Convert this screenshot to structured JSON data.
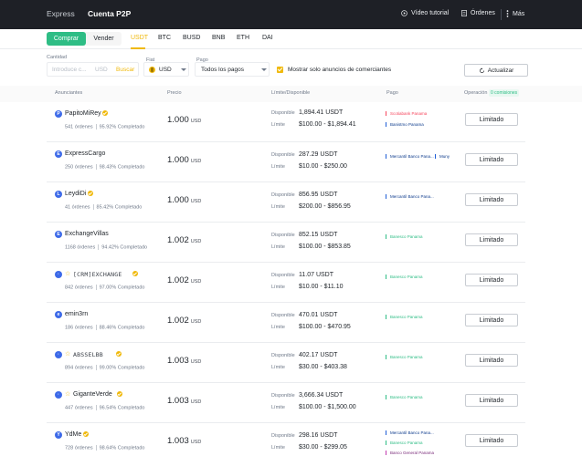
{
  "topbar": {
    "tabs": [
      "Express",
      "Cuenta P2P"
    ],
    "video": "Vídeo tutorial",
    "orders": "Órdenes",
    "more": "Más"
  },
  "nav": {
    "buy": "Comprar",
    "sell": "Vender",
    "assets": [
      "USDT",
      "BTC",
      "BUSD",
      "BNB",
      "ETH",
      "DAI"
    ]
  },
  "filters": {
    "amount_label": "Cantidad",
    "amount_placeholder": "Introduce c...",
    "amount_currency": "USD",
    "search": "Buscar",
    "fiat_label": "Fiat",
    "fiat_value": "USD",
    "payment_label": "Pago",
    "payment_value": "Todos los pagos",
    "merchant_only": "Mostrar solo anuncios de comerciantes",
    "refresh": "Actualizar"
  },
  "table": {
    "headers": [
      "Anunciantes",
      "Precio",
      "Límite/Disponible",
      "Pago",
      "Operación"
    ],
    "fee_badge": "0 comisiones",
    "available_label": "Disponible",
    "limit_label": "Límite",
    "price_unit": "USD",
    "action": "Limitado",
    "rows": [
      {
        "initial": "P",
        "name": "PapitoMiRey",
        "orders": "541 órdenes",
        "rate": "95.92% Completado",
        "price": "1.000",
        "available": "1,894.41 USDT",
        "limit": "$100.00 - $1,894.41",
        "payments": [
          {
            "name": "Scotiabank Panama",
            "color": "red"
          },
          {
            "name": "Banistmo Panama",
            "color": "blue"
          }
        ]
      },
      {
        "initial": "E",
        "name": "ExpressCargo",
        "orders": "250 órdenes",
        "rate": "98.43% Completado",
        "price": "1.000",
        "available": "287.29 USDT",
        "limit": "$10.00 - $250.00",
        "payments": [
          {
            "name": "Mercantil Banco Pana...",
            "color": "blue"
          },
          {
            "name": "Muny",
            "color": "blue"
          }
        ]
      },
      {
        "initial": "L",
        "name": "LeydiDi",
        "orders": "41 órdenes",
        "rate": "85.42% Completado",
        "price": "1.000",
        "available": "856.95 USDT",
        "limit": "$200.00 - $856.95",
        "payments": [
          {
            "name": "Mercantil Banco Pana...",
            "color": "blue"
          }
        ]
      },
      {
        "initial": "E",
        "name": "ExchangeVillas",
        "orders": "1168 órdenes",
        "rate": "94.42% Completado",
        "price": "1.002",
        "available": "852.15 USDT",
        "limit": "$100.00 - $853.85",
        "payments": [
          {
            "name": "Banesco Panama",
            "color": "green"
          }
        ]
      },
      {
        "initial": "·",
        "name": "[CRM]EXCHANGE",
        "orders": "842 órdenes",
        "rate": "97.00% Completado",
        "price": "1.002",
        "available": "11.07 USDT",
        "limit": "$10.00 - $11.10",
        "payments": [
          {
            "name": "Banesco Panama",
            "color": "green"
          }
        ]
      },
      {
        "initial": "e",
        "name": "emin3rn",
        "orders": "186 órdenes",
        "rate": "88.46% Completado",
        "price": "1.002",
        "available": "470.01 USDT",
        "limit": "$100.00 - $470.95",
        "payments": [
          {
            "name": "Banesco Panama",
            "color": "green"
          }
        ]
      },
      {
        "initial": "·",
        "name": "ABSSELBB",
        "orders": "894 órdenes",
        "rate": "99.00% Completado",
        "price": "1.003",
        "available": "402.17 USDT",
        "limit": "$30.00 - $403.38",
        "payments": [
          {
            "name": "Banesco Panama",
            "color": "green"
          }
        ]
      },
      {
        "initial": "·",
        "name": "GiganteVerde",
        "orders": "447 órdenes",
        "rate": "96.54% Completado",
        "price": "1.003",
        "available": "3,666.34 USDT",
        "limit": "$100.00 - $1,500.00",
        "payments": [
          {
            "name": "Banesco Panama",
            "color": "green"
          }
        ]
      },
      {
        "initial": "Y",
        "name": "YdMe",
        "orders": "728 órdenes",
        "rate": "98.64% Completado",
        "price": "1.003",
        "available": "298.16 USDT",
        "limit": "$30.00 - $299.05",
        "payments": [
          {
            "name": "Mercantil Banco Pana...",
            "color": "blue"
          },
          {
            "name": "Banesco Panama",
            "color": "green"
          },
          {
            "name": "Banco General Panama",
            "color": "pink"
          }
        ]
      }
    ]
  }
}
